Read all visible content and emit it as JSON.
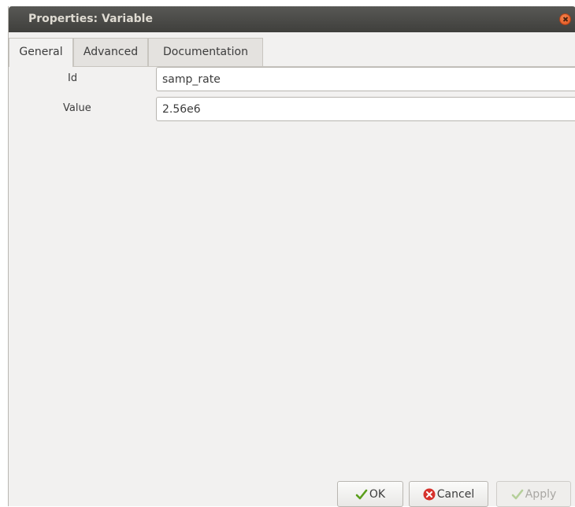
{
  "window": {
    "title": "Properties: Variable"
  },
  "tabs": [
    {
      "label": "General",
      "active": true
    },
    {
      "label": "Advanced",
      "active": false
    },
    {
      "label": "Documentation",
      "active": false
    }
  ],
  "fields": {
    "id": {
      "label": "Id",
      "value": "samp_rate"
    },
    "value": {
      "label": "Value",
      "value": "2.56e6"
    }
  },
  "buttons": {
    "ok": {
      "label": "OK",
      "icon": "checkmark-icon"
    },
    "cancel": {
      "label": "Cancel",
      "icon": "cancel-icon"
    },
    "apply": {
      "label": "Apply",
      "icon": "checkmark-icon",
      "disabled": true
    }
  },
  "colors": {
    "titlebar": "#3f3f3c",
    "close": "#e0501b",
    "ok_check": "#5a9e1b",
    "cancel_red": "#d6322c"
  }
}
